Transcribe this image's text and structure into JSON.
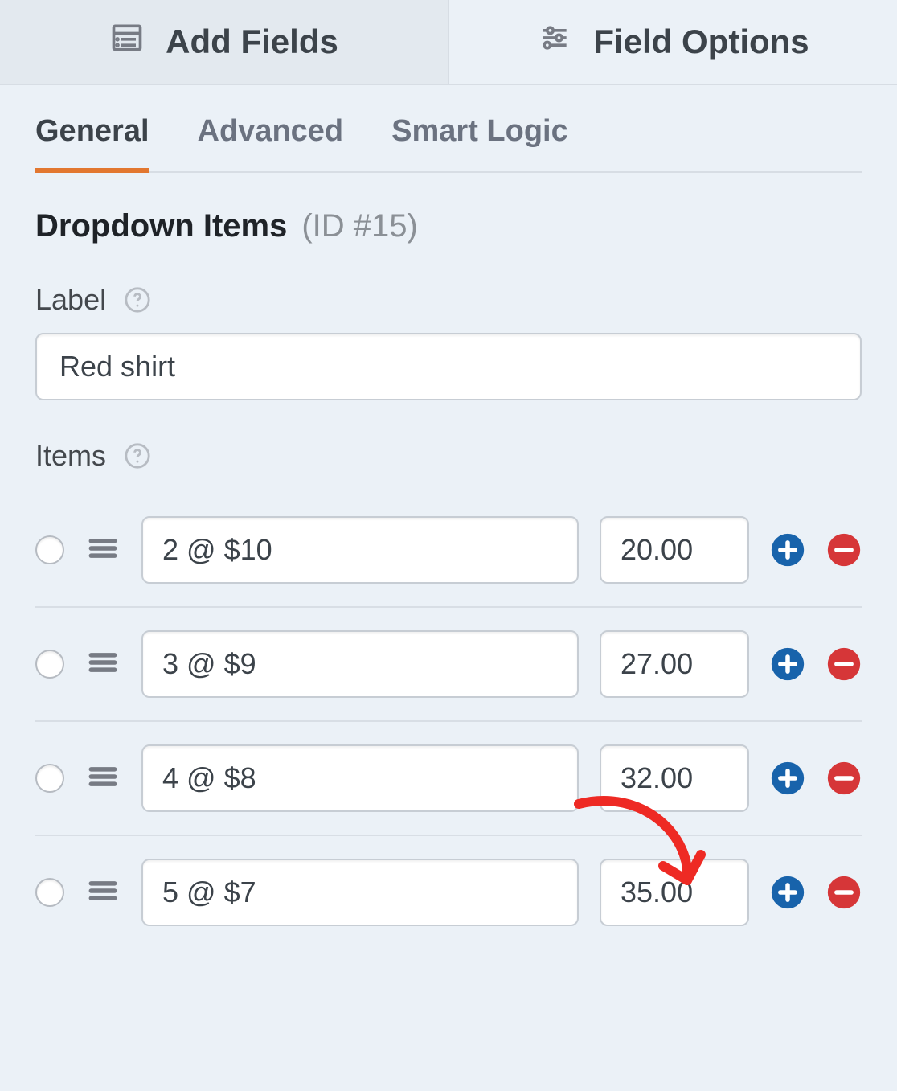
{
  "topTabs": {
    "addFields": "Add Fields",
    "fieldOptions": "Field Options",
    "activeIndex": 0
  },
  "subTabs": {
    "general": "General",
    "advanced": "Advanced",
    "smartLogic": "Smart Logic",
    "activeIndex": 0
  },
  "section": {
    "title": "Dropdown Items",
    "idText": "(ID #15)"
  },
  "labelField": {
    "label": "Label",
    "value": "Red shirt"
  },
  "itemsField": {
    "label": "Items",
    "rows": [
      {
        "text": "2 @ $10",
        "price": "20.00"
      },
      {
        "text": "3 @ $9",
        "price": "27.00"
      },
      {
        "text": "4 @ $8",
        "price": "32.00"
      },
      {
        "text": "5 @ $7",
        "price": "35.00"
      }
    ]
  },
  "icons": {
    "addFields": "list-icon",
    "fieldOptions": "sliders-icon",
    "help": "help-icon",
    "grip": "grip-icon",
    "plus": "plus-circle-icon",
    "minus": "minus-circle-icon"
  },
  "colors": {
    "accentOrange": "#e27730",
    "plusBlue": "#1863ab",
    "minusRed": "#d63638",
    "annotationRed": "#ee2a24"
  }
}
